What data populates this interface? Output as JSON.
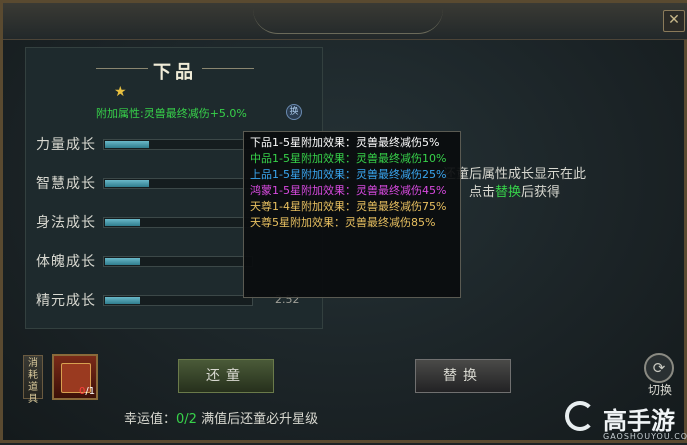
{
  "window": {
    "close_label": "✕"
  },
  "grade": {
    "title": "下品",
    "stars": "★",
    "bonus": "附加属性:灵兽最终减伤+5.0%",
    "switch_icon_label": "换"
  },
  "stats": [
    {
      "label": "力量成长",
      "fill": 0.3,
      "value": ""
    },
    {
      "label": "智慧成长",
      "fill": 0.3,
      "value": ""
    },
    {
      "label": "身法成长",
      "fill": 0.24,
      "value": ""
    },
    {
      "label": "体魄成长",
      "fill": 0.24,
      "value": ""
    },
    {
      "label": "精元成长",
      "fill": 0.24,
      "value": "2.52"
    }
  ],
  "hint": {
    "line1": "还童后属性成长显示在此",
    "line2_prefix": "点击",
    "line2_accent": "替换",
    "line2_suffix": "后获得"
  },
  "tooltip": {
    "lines": [
      {
        "text": "下品1-5星附加效果：灵兽最终减伤5%",
        "color": "white"
      },
      {
        "text": "中品1-5星附加效果：灵兽最终减伤10%",
        "color": "green"
      },
      {
        "text": "上品1-5星附加效果：灵兽最终减伤25%",
        "color": "blue"
      },
      {
        "text": "鸿蒙1-5星附加效果：灵兽最终减伤45%",
        "color": "purple"
      },
      {
        "text": "天尊1-4星附加效果：灵兽最终减伤75%",
        "color": "gold"
      },
      {
        "text": "天尊5星附加效果：灵兽最终减伤85%",
        "color": "gold"
      }
    ]
  },
  "consume": {
    "tag": "消耗道具",
    "item_have": "0",
    "item_need": "/1"
  },
  "buttons": {
    "restore": "还童",
    "replace": "替换",
    "switch": "切换"
  },
  "luck": {
    "label": "幸运值：",
    "value": "0/2",
    "suffix": " 满值后还童必升星级"
  },
  "watermark": {
    "text": "高手游",
    "sub": "GAOSHOUYOU.COM"
  }
}
